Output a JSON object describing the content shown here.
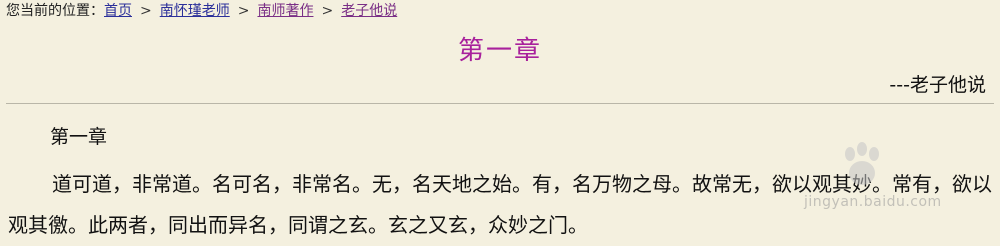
{
  "breadcrumb": {
    "prefix": "您当前的位置：",
    "items": [
      "首页",
      "南怀瑾老师",
      "南师著作",
      "老子他说"
    ],
    "separator": ">"
  },
  "chapter_title": "第一章",
  "author_line": "---老子他说",
  "section_heading": "第一章",
  "paragraph": "道可道，非常道。名可名，非常名。无，名天地之始。有，名万物之母。故常无，欲以观其妙。常有，欲以观其徼。此两者，同出而异名，同谓之玄。玄之又玄，众妙之门。",
  "watermark": {
    "logo_text": "Bai 经验",
    "url": "jingyan.baidu.com"
  },
  "colors": {
    "background": "#f4f0df",
    "title": "#a8219c",
    "link": "#2b2f9a",
    "link_visited": "#7a2f86"
  }
}
